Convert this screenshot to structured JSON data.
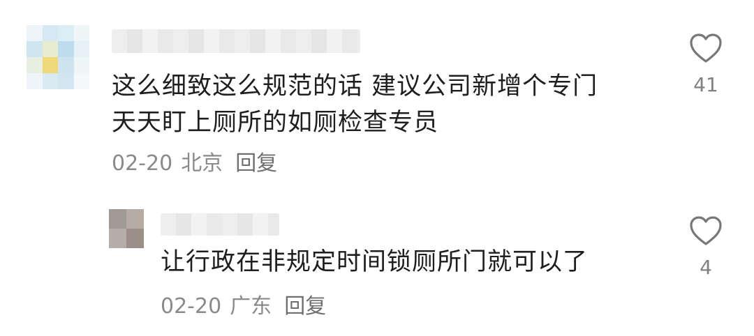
{
  "comments": [
    {
      "text_lines": [
        "这么细致这么规范的话 建议公司新增个专门",
        "天天盯上厕所的如厕检查专员"
      ],
      "date": "02-20",
      "location": "北京",
      "reply_label": "回复",
      "likes": "41",
      "avatar_tiles": [
        "#eef5fa",
        "#d6e8f1",
        "#dbeef5",
        "#eef6f8",
        "#cfe6f1",
        "#e8edd0",
        "#bfdcef",
        "#e7f2f7",
        "#e7efe0",
        "#f0d77a",
        "#cde3ee",
        "#eef5f7",
        "#eef4f7",
        "#d9eaf3",
        "#d2e6f0",
        "#f4f8fa"
      ]
    },
    {
      "text_lines": [
        "让行政在非规定时间锁厕所门就可以了"
      ],
      "date": "02-20",
      "location": "广东",
      "reply_label": "回复",
      "likes": "4",
      "avatar_tiles": [
        "#9f9a94",
        "#b7aca4",
        "#b4aea8",
        "#9b8f87"
      ]
    }
  ],
  "icons": {
    "like": "heart-outline-icon"
  },
  "colors": {
    "text": "#1e1e1e",
    "meta": "#8a8a8a",
    "icon": "#777777"
  }
}
